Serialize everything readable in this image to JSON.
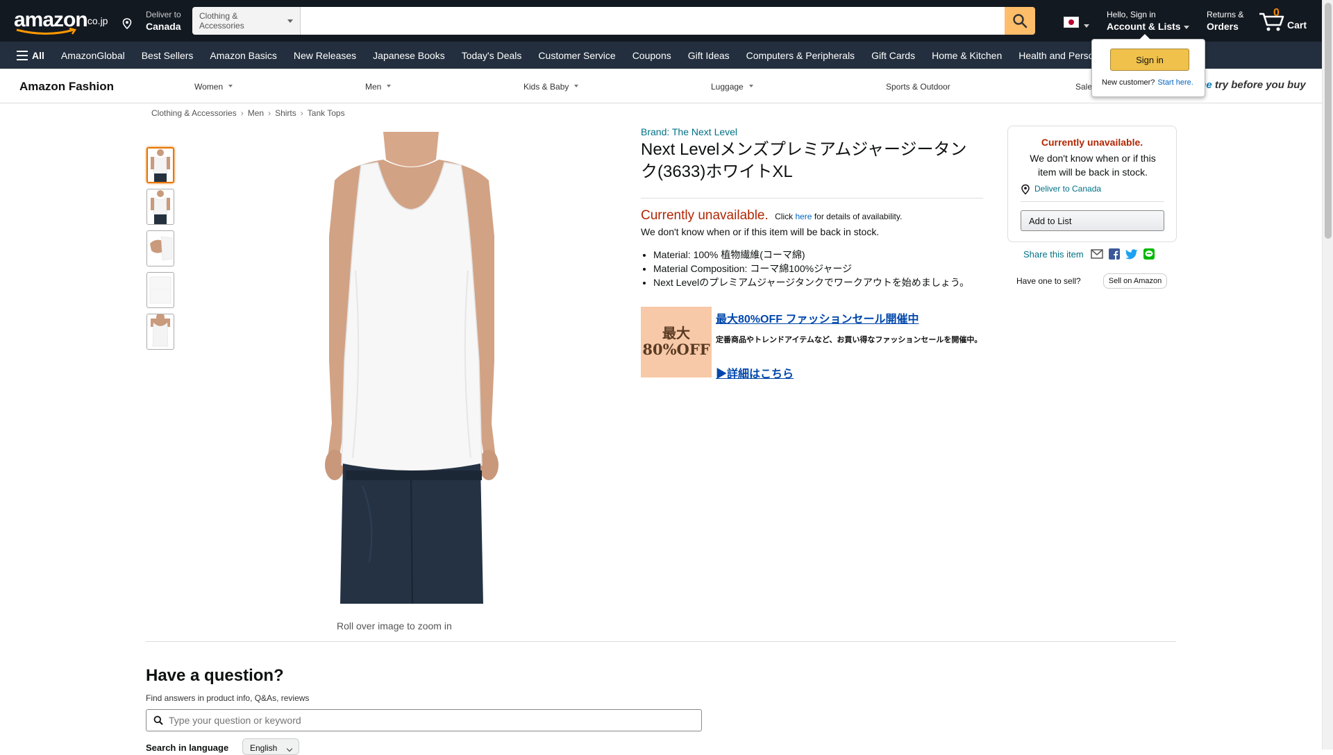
{
  "header": {
    "logo_text": "amazon",
    "logo_tld": ".co.jp",
    "deliver_line1": "Deliver to",
    "deliver_line2": "Canada",
    "search_category": "Clothing & Accessories",
    "search_placeholder": "",
    "account_line1": "Hello, Sign in",
    "account_line2": "Account & Lists",
    "returns_line1": "Returns &",
    "returns_line2": "Orders",
    "cart_count": "0",
    "cart_label": "Cart"
  },
  "subnav": {
    "all_label": "All",
    "items": [
      "AmazonGlobal",
      "Best Sellers",
      "Amazon Basics",
      "New Releases",
      "Japanese Books",
      "Today's Deals",
      "Customer Service",
      "Coupons",
      "Gift Ideas",
      "Computers & Peripherals",
      "Gift Cards",
      "Home & Kitchen",
      "Health and Perso"
    ]
  },
  "signin_popover": {
    "button": "Sign in",
    "new_customer": "New customer?",
    "start_here": "Start here."
  },
  "fashion": {
    "brand": "Amazon Fashion",
    "items": [
      "Women",
      "Men",
      "Kids & Baby",
      "Luggage",
      "Sports & Outdoor",
      "Sale"
    ],
    "promo_prefix": "me",
    "promo_text": " try before you buy"
  },
  "breadcrumb": [
    "Clothing & Accessories",
    "Men",
    "Shirts",
    "Tank Tops"
  ],
  "gallery": {
    "zoom_hint": "Roll over image to zoom in"
  },
  "product": {
    "brand": "Brand: The Next Level",
    "title": "Next Levelメンズプレミアムジャージータンク(3633)ホワイトXL",
    "unavailable_big": "Currently unavailable.",
    "unavailable_click": "Click",
    "unavailable_here": "here",
    "unavailable_rest": "for details of availability.",
    "unavailable_line2": "We don't know when or if this item will be back in stock.",
    "bullets": [
      "Material: 100% 植物繊維(コーマ綿)",
      "Material Composition: コーマ綿100%ジャージ",
      "Next Levelのプレミアムジャージタンクでワークアウトを始めましょう。"
    ]
  },
  "sale": {
    "badge_line1": "最大",
    "badge_line2": "80%OFF",
    "title": "最大80%OFF ファッションセール開催中",
    "description": "定番商品やトレンドアイテムなど、お買い得なファッションセールを開催中。",
    "more": "▶詳細はこちら"
  },
  "buybox": {
    "status": "Currently unavailable.",
    "message": "We don't know when or if this item will be back in stock.",
    "deliver": "Deliver to Canada",
    "add_to_list": "Add to List",
    "share_label": "Share this item",
    "sell_question": "Have one to sell?",
    "sell_button": "Sell on Amazon"
  },
  "question": {
    "title": "Have a question?",
    "subtitle": "Find answers in product info, Q&As, reviews",
    "placeholder": "Type your question or keyword",
    "lang_label": "Search in language",
    "lang_value": "English"
  },
  "colors": {
    "nav_bg": "#131921",
    "subnav_bg": "#232f3e",
    "search_button": "#febd69",
    "link_teal": "#007185",
    "price_red": "#b12704",
    "selected_thumb": "#e77600"
  }
}
